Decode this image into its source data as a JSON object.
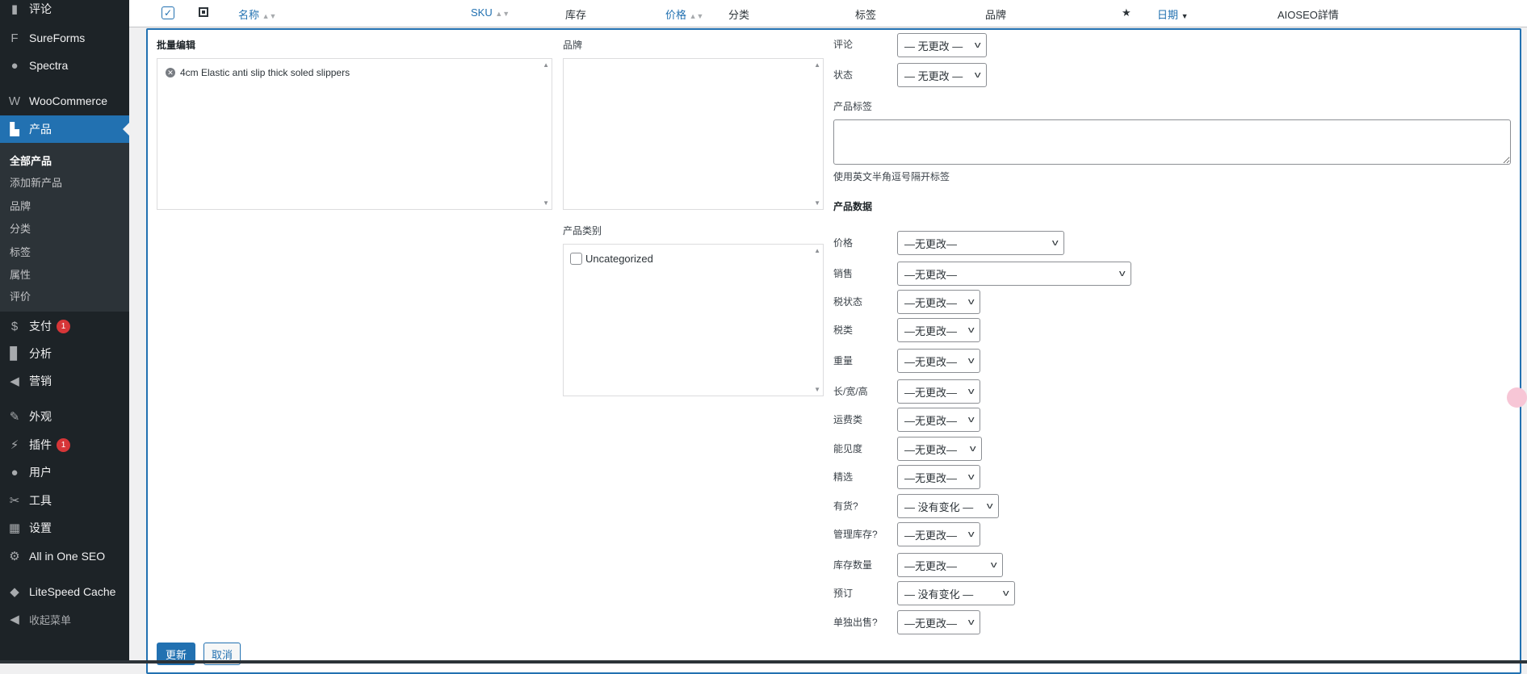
{
  "sidebar": {
    "items": [
      {
        "label": "评论",
        "icon": "comment-icon"
      },
      {
        "label": "SureForms",
        "icon": "sureforms-icon"
      },
      {
        "label": "Spectra",
        "icon": "spectra-icon"
      },
      {
        "label": "WooCommerce",
        "icon": "woocommerce-icon"
      },
      {
        "label": "产品",
        "icon": "product-bag-icon",
        "active": true
      },
      {
        "label": "支付",
        "icon": "payment-icon",
        "badge": "1"
      },
      {
        "label": "分析",
        "icon": "analytics-icon"
      },
      {
        "label": "营销",
        "icon": "megaphone-icon"
      },
      {
        "label": "外观",
        "icon": "brush-icon"
      },
      {
        "label": "插件",
        "icon": "plugin-icon",
        "badge": "1"
      },
      {
        "label": "用户",
        "icon": "user-icon"
      },
      {
        "label": "工具",
        "icon": "wrench-icon"
      },
      {
        "label": "设置",
        "icon": "settings-icon"
      },
      {
        "label": "All in One SEO",
        "icon": "aioseo-icon"
      },
      {
        "label": "LiteSpeed Cache",
        "icon": "litespeed-icon"
      },
      {
        "label": "收起菜单",
        "icon": "collapse-icon"
      }
    ],
    "submenu": [
      "全部产品",
      "添加新产品",
      "品牌",
      "分类",
      "标签",
      "属性",
      "评价"
    ]
  },
  "table_header": {
    "columns": [
      "名称",
      "SKU",
      "库存",
      "价格",
      "分类",
      "标签",
      "品牌",
      "日期",
      "AIOSEO詳情"
    ]
  },
  "bulk_edit": {
    "title": "批量编辑",
    "selected_items": [
      "4cm Elastic anti slip thick soled slippers"
    ],
    "brand_label": "品牌",
    "category_label": "产品类别",
    "categories": [
      "Uncategorized"
    ],
    "comments_label": "评论",
    "comments_value": "— 无更改 —",
    "status_label": "状态",
    "status_value": "— 无更改 —",
    "tags_label": "产品标签",
    "tags_value": "",
    "tags_hint": "使用英文半角逗号隔开标签",
    "product_data_title": "产品数据",
    "fields": [
      {
        "label": "价格",
        "value": "—无更改—"
      },
      {
        "label": "销售",
        "value": "—无更改—"
      },
      {
        "label": "税状态",
        "value": "—无更改—"
      },
      {
        "label": "税类",
        "value": "—无更改—"
      },
      {
        "label": "重量",
        "value": "—无更改—"
      },
      {
        "label": "长/宽/高",
        "value": "—无更改—"
      },
      {
        "label": "运费类",
        "value": "—无更改—"
      },
      {
        "label": "能见度",
        "value": "—无更改—"
      },
      {
        "label": "精选",
        "value": "—无更改—"
      },
      {
        "label": "有货?",
        "value": "— 没有变化 —"
      },
      {
        "label": "管理库存?",
        "value": "—无更改—"
      },
      {
        "label": "库存数量",
        "value": "—无更改—"
      },
      {
        "label": "预订",
        "value": "— 没有变化 —"
      },
      {
        "label": "单独出售?",
        "value": "—无更改—"
      }
    ],
    "update_label": "更新",
    "cancel_label": "取消"
  },
  "colors": {
    "accent": "#2271b1",
    "sidebar": "#1d2327",
    "badge": "#d63638"
  }
}
